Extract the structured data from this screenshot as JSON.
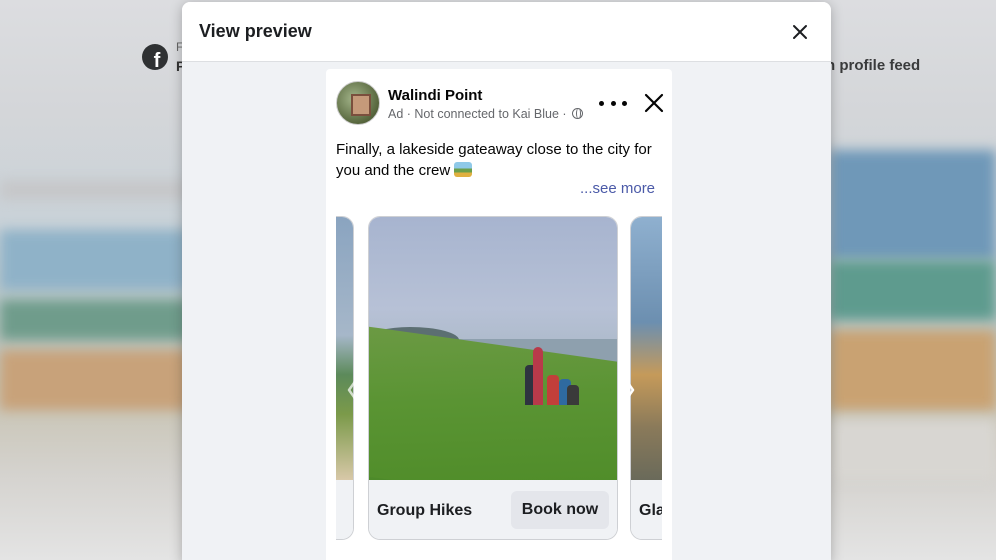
{
  "background": {
    "fb_small_text": "F",
    "fb_bold_text": "P",
    "feed_label": "n profile feed"
  },
  "modal": {
    "title": "View preview"
  },
  "ad": {
    "page_name": "Walindi Point",
    "meta": "Ad · Not connected to Kai Blue ·",
    "primary_text": "Finally, a lakeside gateaway close to the city for you and the crew",
    "see_more": "...see more",
    "carousel": {
      "cards": [
        {
          "title": "",
          "cta": ""
        },
        {
          "title": "Group Hikes",
          "cta": "Book now"
        },
        {
          "title": "Gla",
          "cta": ""
        }
      ]
    }
  },
  "icons": {
    "facebook": "facebook-logo-icon",
    "modal_close": "close-icon",
    "globe": "globe-icon",
    "more": "more-options-icon",
    "hide_ad": "close-icon",
    "emoji": "lake-scene-emoji-icon",
    "prev": "chevron-left-icon",
    "next": "chevron-right-icon"
  },
  "colors": {
    "link": "#4b5aa8",
    "button_bg": "#e4e6eb",
    "modal_bg": "#f0f2f5",
    "text_primary": "#050505",
    "text_secondary": "#65676b"
  }
}
